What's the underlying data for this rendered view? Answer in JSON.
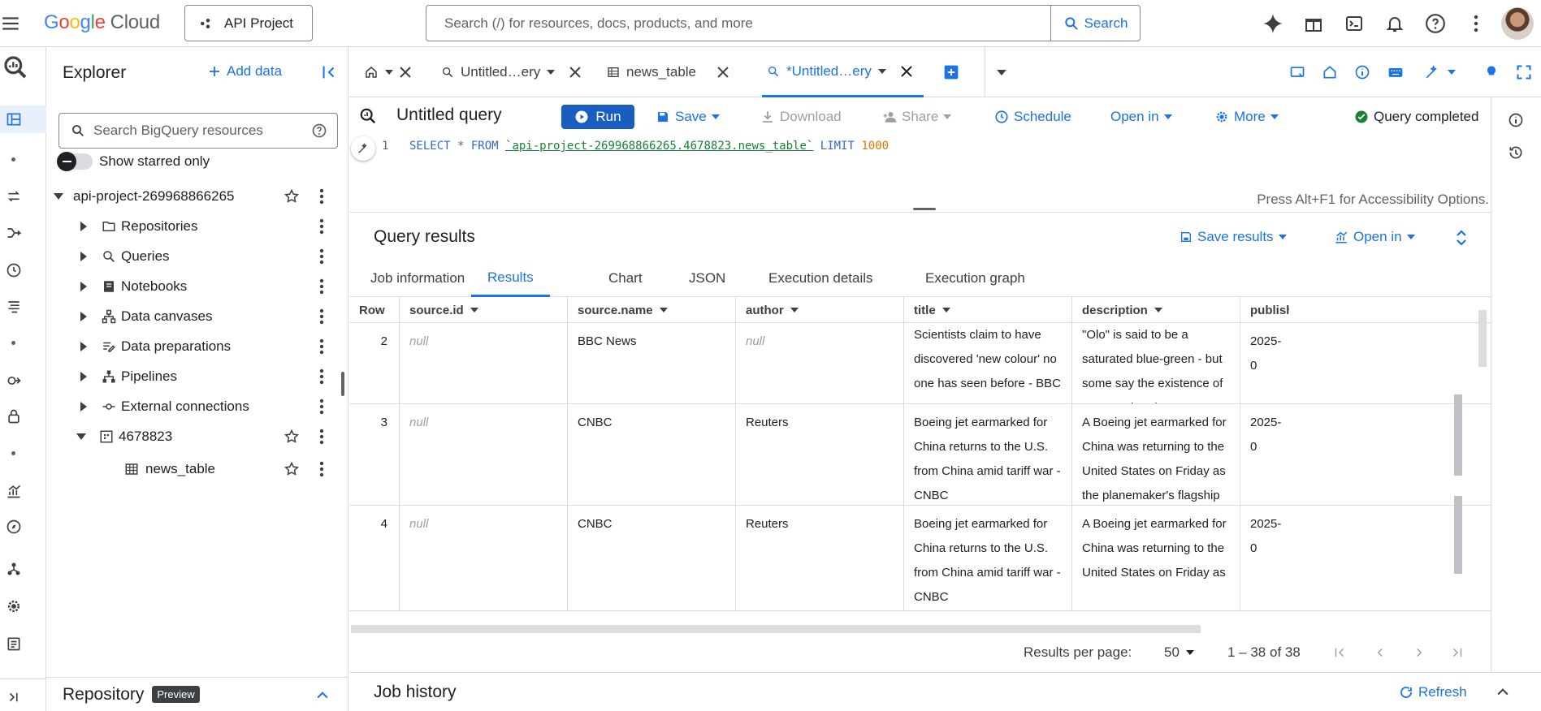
{
  "brand": {
    "g": "G",
    "o1": "o",
    "o2": "o",
    "g2": "g",
    "l": "l",
    "e": "e",
    "cloud": "Cloud"
  },
  "project_button": "API Project",
  "search": {
    "placeholder": "Search (/) for resources, docs, products, and more",
    "button": "Search"
  },
  "explorer": {
    "title": "Explorer",
    "add_data": "Add data",
    "search_placeholder": "Search BigQuery resources",
    "show_starred": "Show starred only",
    "project": "api-project-269968866265",
    "items": [
      "Repositories",
      "Queries",
      "Notebooks",
      "Data canvases",
      "Data preparations",
      "Pipelines",
      "External connections"
    ],
    "dataset": "4678823",
    "table": "news_table"
  },
  "repository": {
    "title": "Repository",
    "badge": "Preview"
  },
  "tabs": [
    "Untitled…ery",
    "news_table",
    "*Untitled…ery"
  ],
  "query": {
    "title": "Untitled query",
    "run": "Run",
    "save": "Save",
    "download": "Download",
    "share": "Share",
    "schedule": "Schedule",
    "open_in": "Open in",
    "more": "More",
    "status": "Query completed"
  },
  "editor": {
    "line": "1",
    "kw1": "SELECT",
    "mid1": " * ",
    "kw2": "FROM",
    "table_ref": "`api-project-269968866265.4678823.news_table`",
    "kw3": "LIMIT",
    "limit": "1000",
    "a11y": "Press Alt+F1 for Accessibility Options."
  },
  "results": {
    "title": "Query results",
    "save_results": "Save results",
    "open_in": "Open in",
    "tabs": [
      "Job information",
      "Results",
      "Chart",
      "JSON",
      "Execution details",
      "Execution graph"
    ],
    "columns": [
      "Row",
      "source.id",
      "source.name",
      "author",
      "title",
      "description",
      "publish"
    ],
    "rows": [
      {
        "row": "2",
        "source_id": "null",
        "source_name": "BBC News",
        "author": "null",
        "title": "Scientists claim to have discovered 'new colour' no one has seen before - BBC",
        "description": "\"Olo\" is said to be a saturated blue-green - but some say the existence of a new colour is \"open to argument\".",
        "publish": "2025-0"
      },
      {
        "row": "3",
        "source_id": "null",
        "source_name": "CNBC",
        "author": "Reuters",
        "title": "Boeing jet earmarked for China returns to the U.S. from China amid tariff war - CNBC",
        "description": "A Boeing jet earmarked for China was returning to the United States on Friday as the planemaker's flagship delivery plant was drawn",
        "publish": "2025-0"
      },
      {
        "row": "4",
        "source_id": "null",
        "source_name": "CNBC",
        "author": "Reuters",
        "title": "Boeing jet earmarked for China returns to the U.S. from China amid tariff war - CNBC",
        "description": "A Boeing jet earmarked for China was returning to the United States on Friday as",
        "publish": "2025-0"
      }
    ],
    "per_page_label": "Results per page:",
    "per_page": "50",
    "range": "1 – 38 of 38"
  },
  "job_history": {
    "title": "Job history",
    "refresh": "Refresh"
  },
  "colors": {
    "accent": "#1a73e8",
    "run_button": "#1a5dc1",
    "success": "#188038"
  }
}
